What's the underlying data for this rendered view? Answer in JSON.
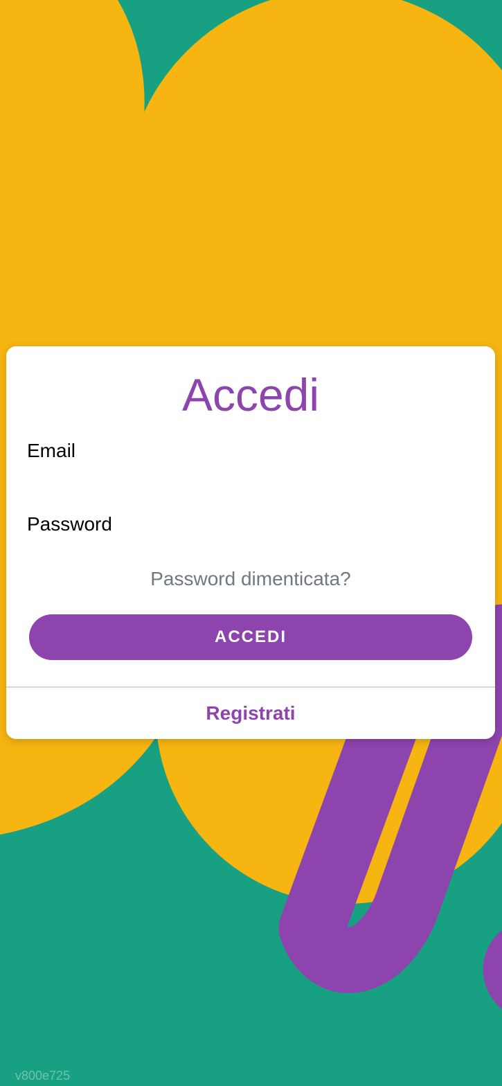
{
  "login": {
    "title": "Accedi",
    "email_label": "Email",
    "email_value": "",
    "password_label": "Password",
    "password_value": "",
    "forgot_password": "Password dimenticata?",
    "submit_label": "ACCEDI",
    "register_link": "Registrati"
  },
  "version": "v800e725",
  "colors": {
    "background_teal": "#18a082",
    "shape_yellow": "#f7b512",
    "accent_purple": "#8e44ad",
    "card": "#ffffff",
    "muted_text": "#6e7880"
  }
}
